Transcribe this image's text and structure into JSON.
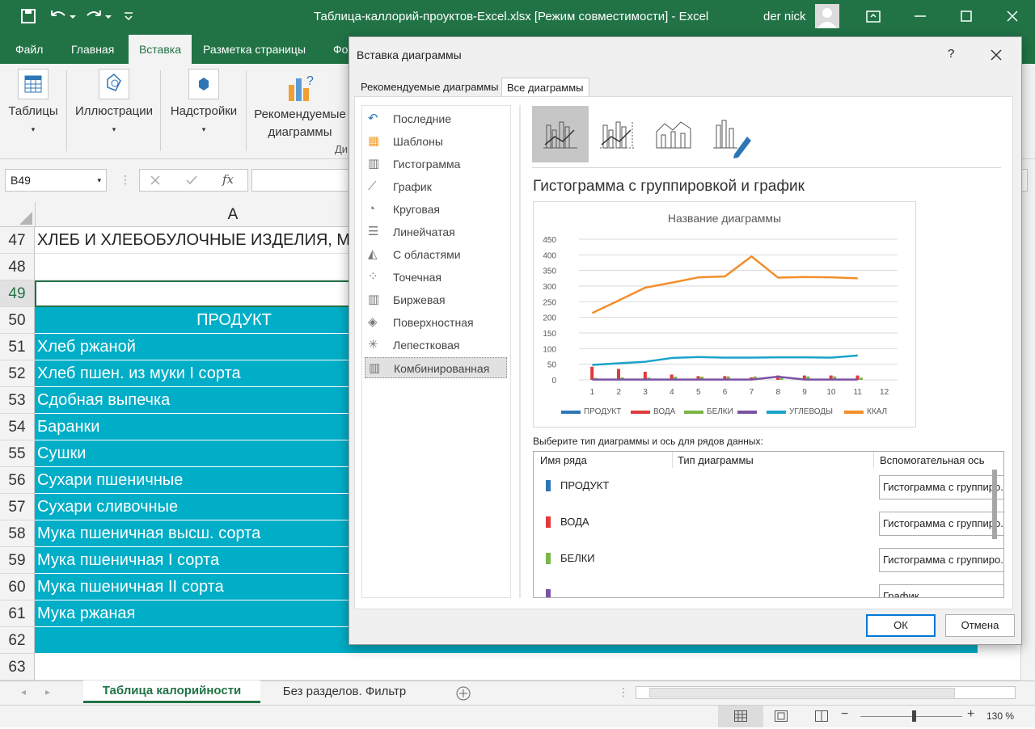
{
  "window": {
    "title": "Таблица-каллорий-проуктов-Excel.xlsx  [Режим совместимости]  -  Excel",
    "user": "der nick"
  },
  "ribbon_tabs": [
    "Файл",
    "Главная",
    "Вставка",
    "Разметка страницы",
    "Фо"
  ],
  "ribbon_groups": {
    "tables": "Таблицы",
    "illustrations": "Иллюстрации",
    "addins": "Надстройки",
    "rec_charts_1": "Рекомендуемые",
    "rec_charts_2": "диаграммы",
    "group_label": "Ди"
  },
  "formula_bar": {
    "name_box": "B49",
    "fx": "fx",
    "content": ""
  },
  "column_header": "A",
  "rows": [
    {
      "num": "47",
      "text": "ХЛЕБ И ХЛЕБОБУЛОЧНЫЕ ИЗДЕЛИЯ, МУ"
    },
    {
      "num": "48",
      "text": ""
    },
    {
      "num": "49",
      "text": ""
    },
    {
      "num": "50",
      "text": "ПРОДУКТ"
    },
    {
      "num": "51",
      "text": "Хлеб ржаной"
    },
    {
      "num": "52",
      "text": "Хлеб пшен. из муки I сорта"
    },
    {
      "num": "53",
      "text": "Сдобная выпечка"
    },
    {
      "num": "54",
      "text": "Баранки"
    },
    {
      "num": "55",
      "text": "Сушки"
    },
    {
      "num": "56",
      "text": "Сухари пшеничные"
    },
    {
      "num": "57",
      "text": "Сухари сливочные"
    },
    {
      "num": "58",
      "text": "Мука пшеничная высш. сорта"
    },
    {
      "num": "59",
      "text": "Мука пшеничная I сорта"
    },
    {
      "num": "60",
      "text": "Мука пшеничная II сорта"
    },
    {
      "num": "61",
      "text": "Мука ржаная"
    },
    {
      "num": "62",
      "text": ""
    },
    {
      "num": "63",
      "text": ""
    }
  ],
  "sheet_tabs": [
    "Таблица калорийности",
    "Без разделов. Фильтр"
  ],
  "status": {
    "zoom": "130 %"
  },
  "dialog": {
    "title": "Вставка диаграммы",
    "help": "?",
    "tabs": [
      "Рекомендуемые диаграммы",
      "Все диаграммы"
    ],
    "categories": [
      "Последние",
      "Шаблоны",
      "Гистограмма",
      "График",
      "Круговая",
      "Линейчатая",
      "С областями",
      "Точечная",
      "Биржевая",
      "Поверхностная",
      "Лепестковая",
      "Комбинированная"
    ],
    "selected_type_title": "Гистограмма с группировкой и график",
    "series_prompt": "Выберите тип диаграммы и ось для рядов данных:",
    "table_headers": [
      "Имя ряда",
      "Тип диаграммы",
      "Вспомогательная ось"
    ],
    "series_rows": [
      {
        "name": "ПРОДУКТ",
        "color": "#2e75b6",
        "type": "Гистограмма с группиро..."
      },
      {
        "name": "ВОДА",
        "color": "#e03b3b",
        "type": "Гистограмма с группиро..."
      },
      {
        "name": "БЕЛКИ",
        "color": "#7ab648",
        "type": "Гистограмма с группиро..."
      },
      {
        "name": "",
        "color": "#7b52a3",
        "type": "График"
      }
    ],
    "ok": "ОК",
    "cancel": "Отмена"
  },
  "chart_data": {
    "type": "bar",
    "title": "Название диаграммы",
    "x": [
      1,
      2,
      3,
      4,
      5,
      6,
      7,
      8,
      9,
      10,
      11,
      12
    ],
    "ylim": [
      0,
      450
    ],
    "yticks": [
      0,
      50,
      100,
      150,
      200,
      250,
      300,
      350,
      400,
      450
    ],
    "legend_position": "bottom",
    "series": [
      {
        "name": "ПРОДУКТ",
        "kind": "bar",
        "color": "#2e75b6",
        "values": [
          0,
          0,
          0,
          0,
          0,
          0,
          0,
          0,
          0,
          0,
          0
        ]
      },
      {
        "name": "ВОДА",
        "kind": "bar",
        "color": "#e03b3b",
        "values": [
          42,
          35,
          26,
          17,
          12,
          12,
          8,
          14,
          14,
          14,
          14
        ]
      },
      {
        "name": "БЕЛКИ",
        "kind": "bar",
        "color": "#7ab648",
        "values": [
          6,
          8,
          7,
          10,
          10,
          11,
          11,
          11,
          11,
          11,
          7
        ]
      },
      {
        "name": "",
        "kind": "line",
        "color": "#7b52a3",
        "values": [
          1,
          1,
          1,
          1,
          1,
          1,
          1,
          10,
          1,
          1,
          1
        ]
      },
      {
        "name": "УГЛЕВОДЫ",
        "kind": "line",
        "color": "#1aa3c9",
        "values": [
          48,
          53,
          58,
          70,
          73,
          71,
          71,
          72,
          72,
          71,
          78
        ]
      },
      {
        "name": "ККАЛ",
        "kind": "line",
        "color": "#f28e2b",
        "values": [
          214,
          254,
          295,
          311,
          328,
          331,
          395,
          327,
          329,
          328,
          325
        ]
      }
    ]
  }
}
